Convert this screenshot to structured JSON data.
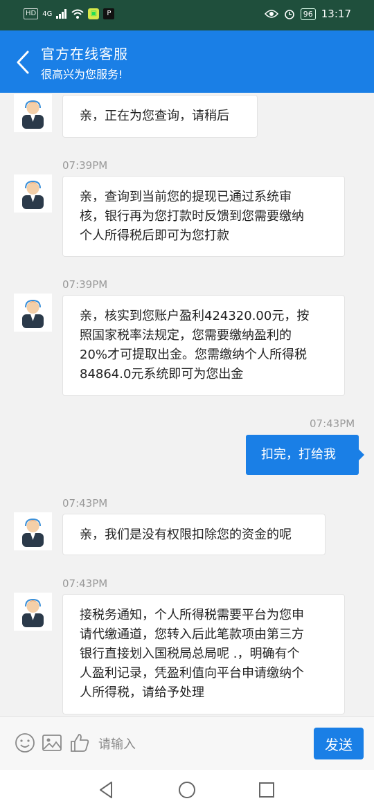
{
  "status_bar": {
    "left_chips": [
      "HD",
      "4G"
    ],
    "app_icon_2": "P",
    "battery": "96",
    "time": "13:17"
  },
  "header": {
    "title": "官方在线客服",
    "subtitle": "很高兴为您服务!"
  },
  "messages": [
    {
      "side": "agent",
      "time": "",
      "text_lines": [
        "亲，正在为您查询，请稍后"
      ]
    },
    {
      "side": "agent",
      "time": "07:39PM",
      "text_lines": [
        "亲，查询到当前您的提现已通过系统审",
        "核，银行再为您打款时反馈到您需要缴纳",
        "个人所得税后即可为您打款"
      ]
    },
    {
      "side": "agent",
      "time": "07:39PM",
      "text_lines": [
        "亲，核实到您账户盈利424320.00元，按",
        "照国家税率法规定，您需要缴纳盈利的",
        "20%才可提取出金。您需缴纳个人所得税",
        "84864.0元系统即可为您出金"
      ]
    },
    {
      "side": "user",
      "time": "07:43PM",
      "text_lines": [
        "扣完，打给我"
      ]
    },
    {
      "side": "agent",
      "time": "07:43PM",
      "text_lines": [
        "亲，我们是没有权限扣除您的资金的呢"
      ]
    },
    {
      "side": "agent",
      "time": "07:43PM",
      "text_lines": [
        "接税务通知，个人所得税需要平台为您申",
        "请代缴通道，您转入后此笔款项由第三方",
        "银行直接划入国税局总局呢 .，明确有个",
        "人盈利记录，凭盈利值向平台申请缴纳个",
        "人所得税，请给予处理"
      ]
    }
  ],
  "input": {
    "placeholder": "请输入",
    "send_label": "发送",
    "icons": [
      "emoji-icon",
      "image-icon",
      "thumbs-up-icon"
    ]
  },
  "colors": {
    "status_bar": "#1f4f3c",
    "accent": "#1a7fe6",
    "background": "#f2f2f2"
  }
}
